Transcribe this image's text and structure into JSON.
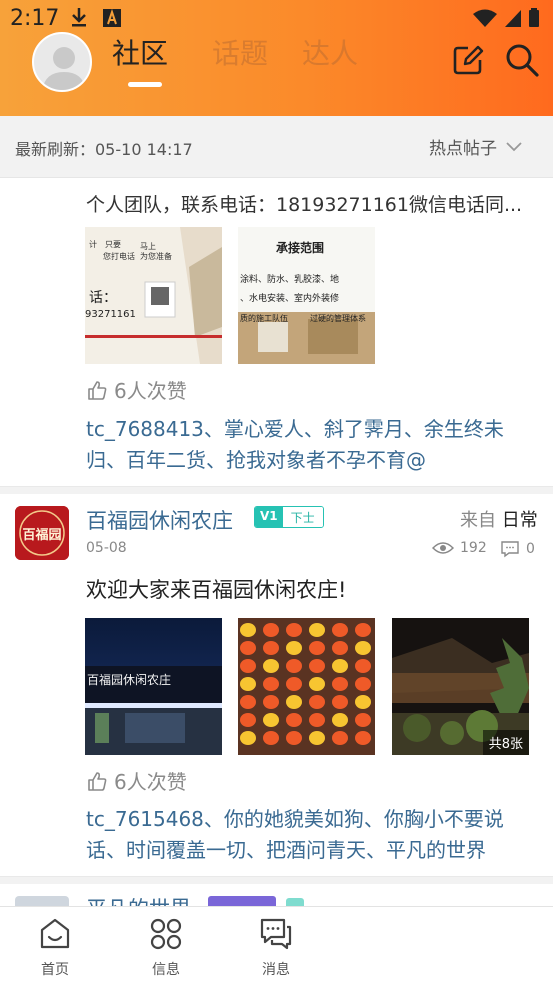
{
  "status_bar": {
    "time": "2:17"
  },
  "header": {
    "tabs": [
      {
        "label": "社区",
        "active": true
      },
      {
        "label": "话题",
        "active": false
      },
      {
        "label": "达人",
        "active": false
      }
    ]
  },
  "refresh_bar": {
    "refresh_text": "最新刷新：05-10 14:17",
    "sort_label": "热点帖子"
  },
  "posts": [
    {
      "text": "个人团队，联系电话：18193271161微信电话同...",
      "images": [
        {
          "lines": [
            "计",
            "只要",
            "马上",
            "您打电话",
            "为您准备",
            "话：",
            "93271161"
          ]
        },
        {
          "lines": [
            "承接范围",
            "涂料、防水、乳胶漆、地",
            "、水电安装、室内外装修",
            "质的施工队伍",
            "过硬的管理体系"
          ]
        }
      ],
      "likes": "6人次赞",
      "likers": "tc_7688413、掌心爱人、斜了霁月、余生终未归、百年二货、抢我对象者不孕不育@"
    },
    {
      "author": "百福园休闲农庄",
      "logo_text": "百福园",
      "badge_v": "V1",
      "badge_rank": "下士",
      "source_prefix": "来自",
      "source_name": "日常",
      "date": "05-08",
      "views": "192",
      "comments": "0",
      "text": "欢迎大家来百福园休闲农庄!",
      "images": [
        {
          "sign": "百福园休闲农庄"
        },
        {},
        {
          "count_label": "共8张"
        }
      ],
      "likes": "6人次赞",
      "likers": "tc_7615468、你的她貌美如狗、你胸小不要说话、时间覆盖一切、把酒问青天、平凡的世界"
    },
    {
      "author": "平凡的世界"
    }
  ],
  "bottom_nav": [
    {
      "label": "首页",
      "icon": "home-icon"
    },
    {
      "label": "信息",
      "icon": "grid-icon"
    },
    {
      "label": "消息",
      "icon": "chat-icon"
    }
  ],
  "colors": {
    "header_gradient_start": "#f7a23a",
    "header_gradient_end": "#ff6a1e",
    "link_blue": "#3a6a92",
    "badge_teal": "#26c2b3",
    "logo_red": "#b8191d"
  }
}
